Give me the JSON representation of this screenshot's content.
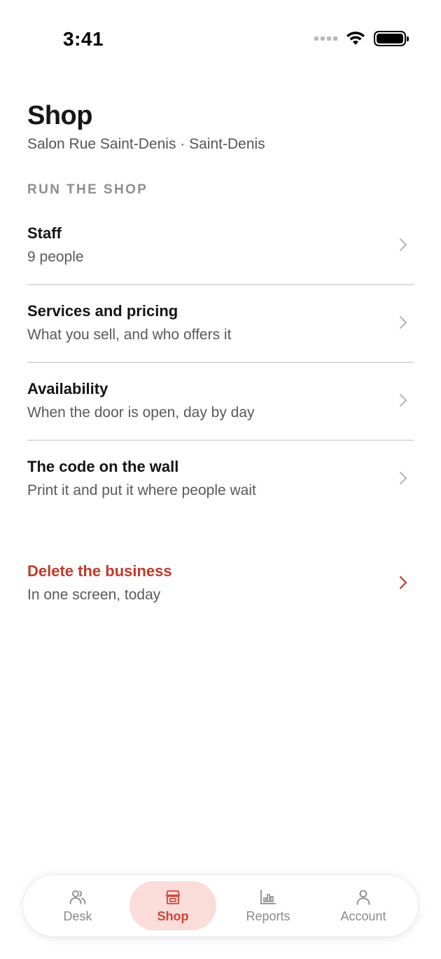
{
  "status_bar": {
    "time": "3:41"
  },
  "header": {
    "title": "Shop",
    "subtitle": "Salon Rue Saint-Denis · Saint-Denis"
  },
  "section": {
    "label": "RUN THE SHOP"
  },
  "items": [
    {
      "title": "Staff",
      "description": "9 people",
      "icon": "chevron-right-icon"
    },
    {
      "title": "Services and pricing",
      "description": "What you sell, and who offers it",
      "icon": "chevron-right-icon"
    },
    {
      "title": "Availability",
      "description": "When the door is open, day by day",
      "icon": "chevron-right-icon"
    },
    {
      "title": "The code on the wall",
      "description": "Print it and put it where people wait",
      "icon": "chevron-right-icon"
    }
  ],
  "danger": {
    "title": "Delete the business",
    "description": "In one screen, today",
    "icon": "chevron-right-icon"
  },
  "tab_bar": {
    "tabs": [
      {
        "label": "Desk",
        "icon": "people-icon",
        "active": false
      },
      {
        "label": "Shop",
        "icon": "storefront-icon",
        "active": true
      },
      {
        "label": "Reports",
        "icon": "bar-chart-icon",
        "active": false
      },
      {
        "label": "Account",
        "icon": "person-icon",
        "active": false
      }
    ]
  },
  "colors": {
    "accent": "#d2453d",
    "danger": "#c0392b",
    "active_tab_bg": "#fadcd8",
    "divider": "#dcdcdc"
  }
}
